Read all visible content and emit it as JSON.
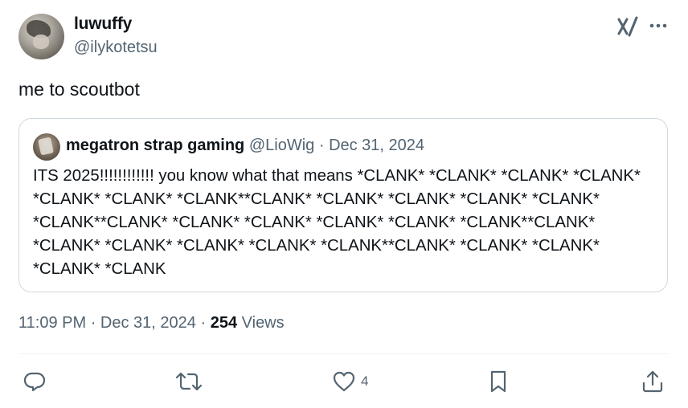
{
  "author": {
    "display_name": "luwuffy",
    "handle": "@ilykotetsu"
  },
  "tweet": {
    "text": "me to scoutbot"
  },
  "quoted": {
    "display_name": "megatron strap gaming",
    "handle": "@LioWig",
    "separator": "·",
    "date": "Dec 31, 2024",
    "text": "ITS 2025!!!!!!!!!!!! you know what that means *CLANK* *CLANK* *CLANK* *CLANK* *CLANK* *CLANK* *CLANK**CLANK* *CLANK* *CLANK* *CLANK* *CLANK* *CLANK**CLANK* *CLANK* *CLANK* *CLANK* *CLANK* *CLANK**CLANK* *CLANK* *CLANK* *CLANK* *CLANK* *CLANK**CLANK* *CLANK* *CLANK* *CLANK* *CLANK"
  },
  "meta": {
    "time": "11:09 PM",
    "sep1": "·",
    "date": "Dec 31, 2024",
    "sep2": "·",
    "views_count": "254",
    "views_label": "Views"
  },
  "actions": {
    "reply_icon": "reply-icon",
    "retweet_icon": "retweet-icon",
    "like_icon": "heart-icon",
    "like_count": "4",
    "bookmark_icon": "bookmark-icon",
    "share_icon": "share-icon"
  },
  "colors": {
    "text": "#0f1419",
    "secondary": "#536471",
    "border": "#cfd9de",
    "divider": "#eff3f4"
  }
}
